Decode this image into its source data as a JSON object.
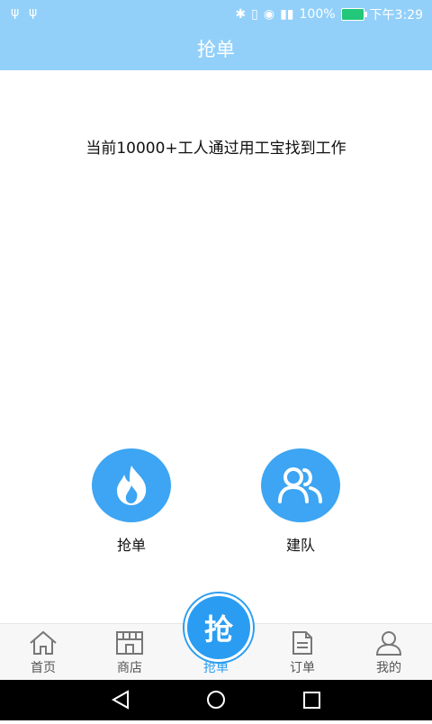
{
  "status_bar": {
    "battery": "100%",
    "time": "下午3:29"
  },
  "header": {
    "title": "抢单"
  },
  "promo": {
    "text": "当前10000+工人通过用工宝找到工作"
  },
  "actions": [
    {
      "label": "抢单",
      "icon": "flame-icon"
    },
    {
      "label": "建队",
      "icon": "people-icon"
    }
  ],
  "bottom_nav": {
    "center_badge": "抢",
    "items": [
      {
        "label": "首页",
        "icon": "home-icon"
      },
      {
        "label": "商店",
        "icon": "store-icon"
      },
      {
        "label": "抢单",
        "icon": "grab-icon",
        "active": true
      },
      {
        "label": "订单",
        "icon": "document-icon"
      },
      {
        "label": "我的",
        "icon": "user-icon"
      }
    ]
  },
  "colors": {
    "header_bg": "#92d0fa",
    "accent": "#2a9df2",
    "action_circle": "#3da5f3"
  }
}
